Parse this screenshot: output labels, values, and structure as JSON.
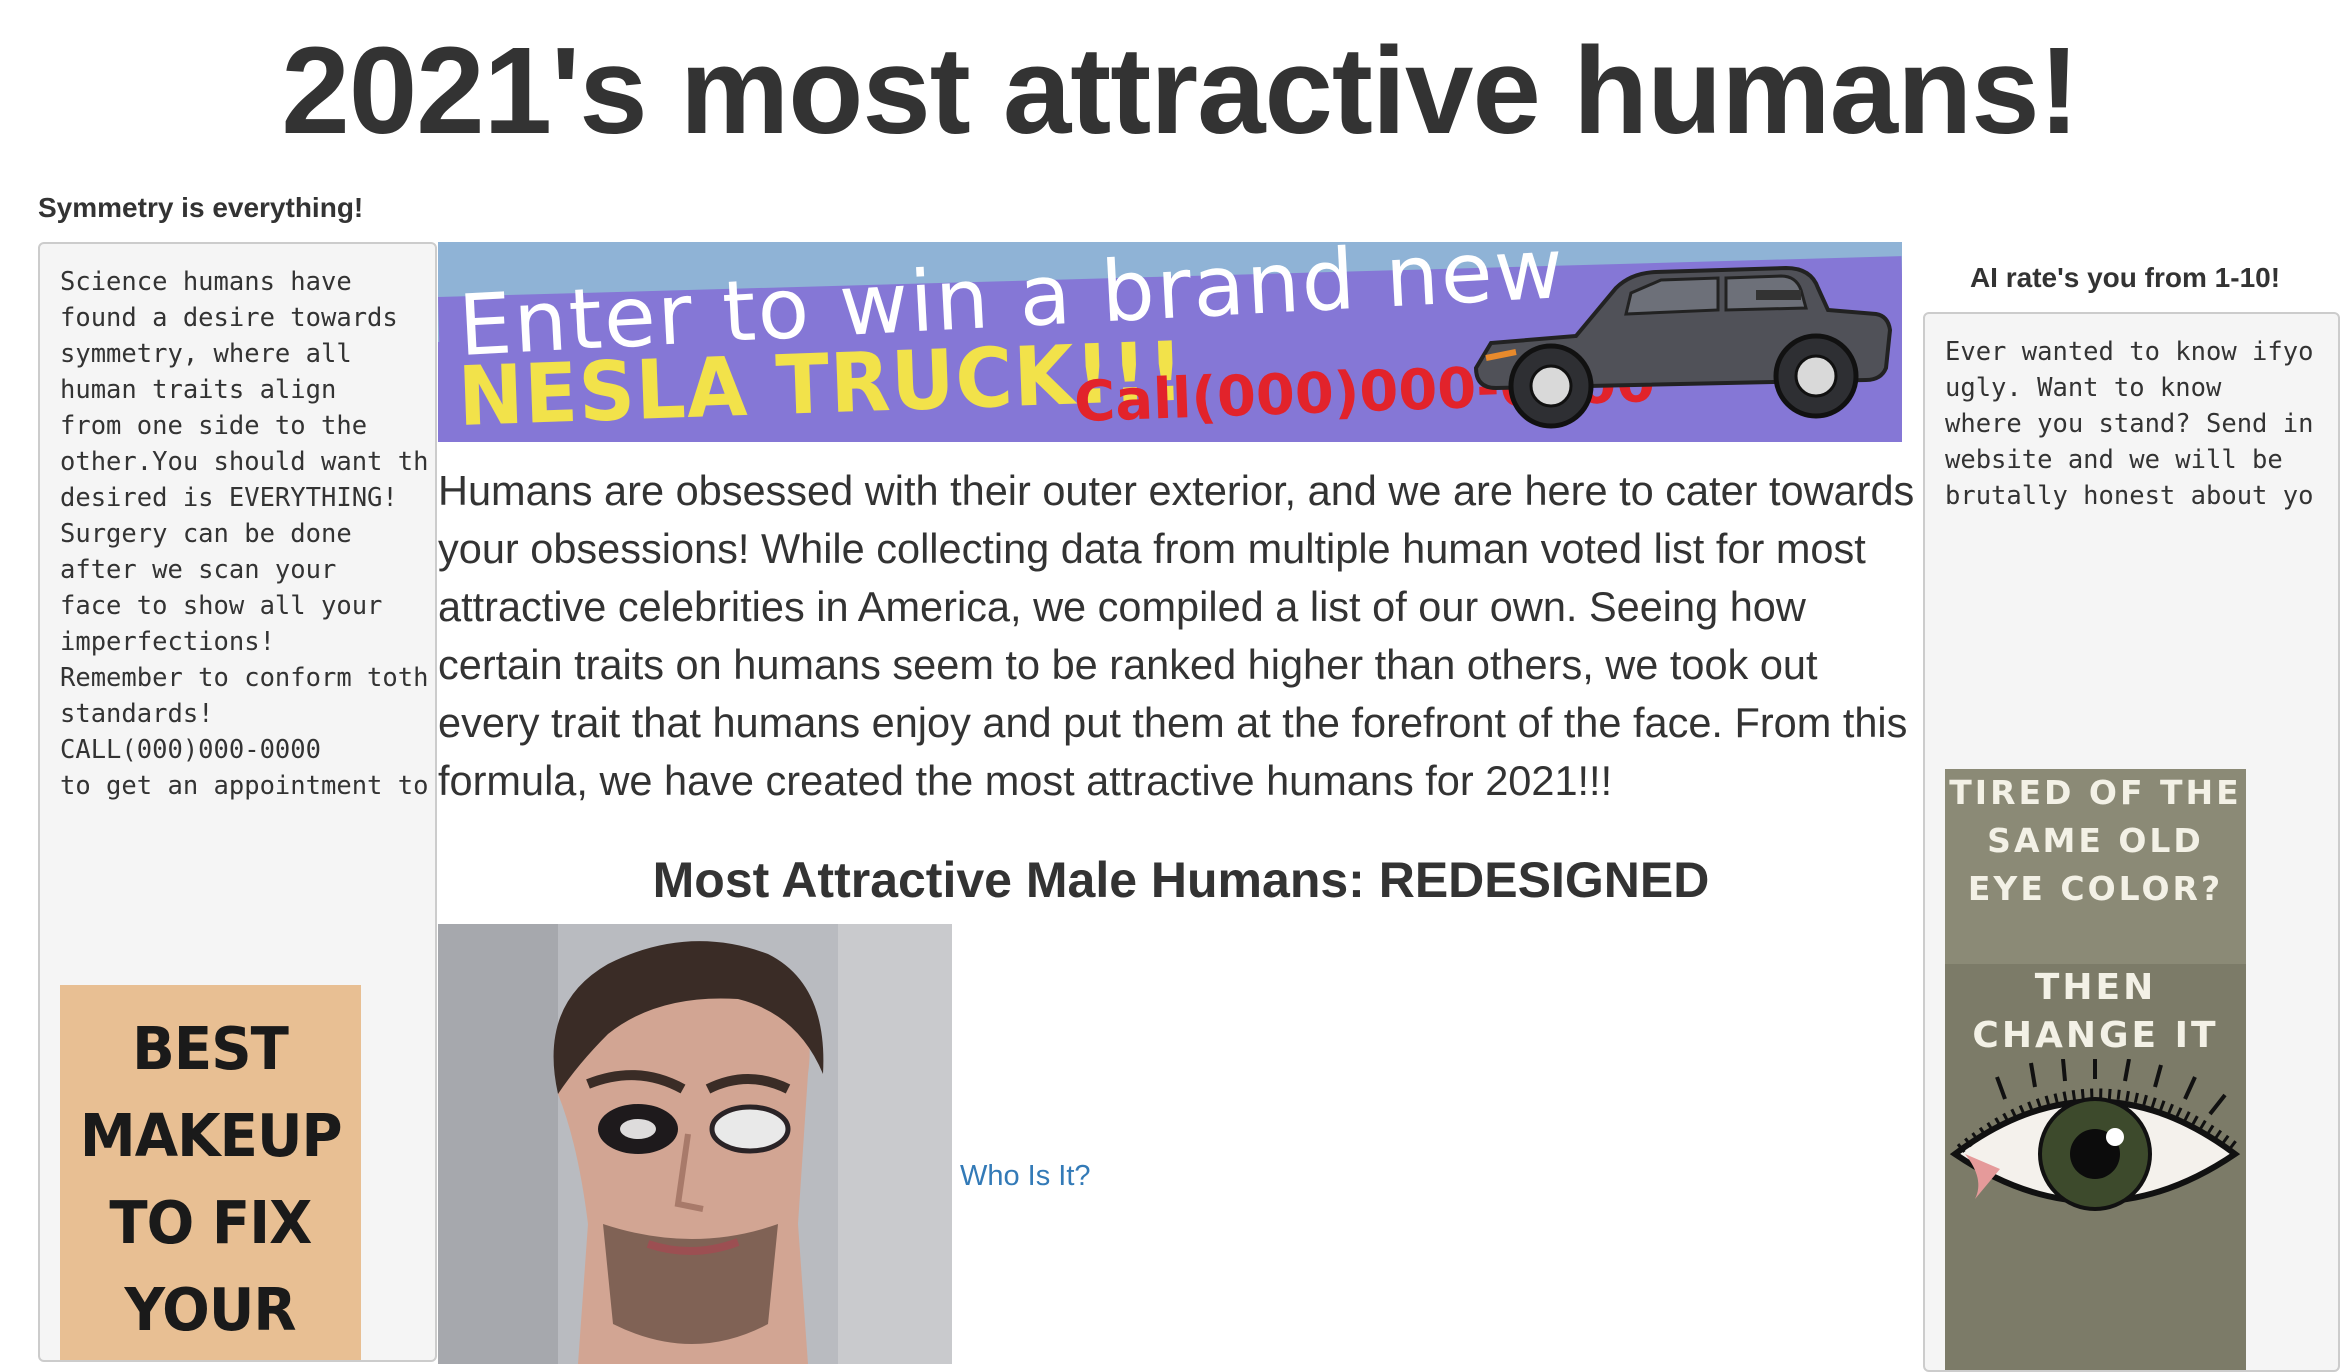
{
  "page": {
    "title": "2021's most attractive humans!"
  },
  "left": {
    "heading": "Symmetry is everything!",
    "text": "Science humans have\nfound a desire towards\nsymmetry, where all\nhuman traits align\nfrom one side to the\nother.You should want th\ndesired is EVERYTHING!\nSurgery can be done\nafter we scan your\nface to show all your\nimperfections!\nRemember to conform toth\nstandards!\nCALL(000)000-0000\nto get an appointment to",
    "makeup_ad_lines": [
      "BEST",
      "MAKEUP",
      "TO FIX",
      "YOUR"
    ]
  },
  "banner": {
    "line1": "Enter to win a brand new",
    "line2": "NESLA TRUCK!!!",
    "phone": "Call(000)000-0000"
  },
  "main": {
    "intro": "Humans are obsessed with their outer exterior, and we are here to cater towards your obsessions! While collecting data from multiple human voted list for most attractive celebrities in America, we compiled a list of our own. Seeing how certain traits on humans seem to be ranked higher than others, we took out every trait that humans enjoy and put them at the forefront of the face. From this formula, we have created the most attractive humans for 2021!!!",
    "section_heading": "Most Attractive Male Humans: REDESIGNED",
    "link_text": "Who Is It?"
  },
  "right": {
    "heading": "AI rate's you from 1-10!",
    "text": "Ever wanted to know ifyo\nugly. Want to know\nwhere you stand? Send in\nwebsite and we will be\nbrutally honest about yo",
    "eye_ad_top": "TIRED OF THE\nSAME OLD\nEYE COLOR?",
    "eye_ad_bottom": "THEN\nCHANGE IT"
  }
}
